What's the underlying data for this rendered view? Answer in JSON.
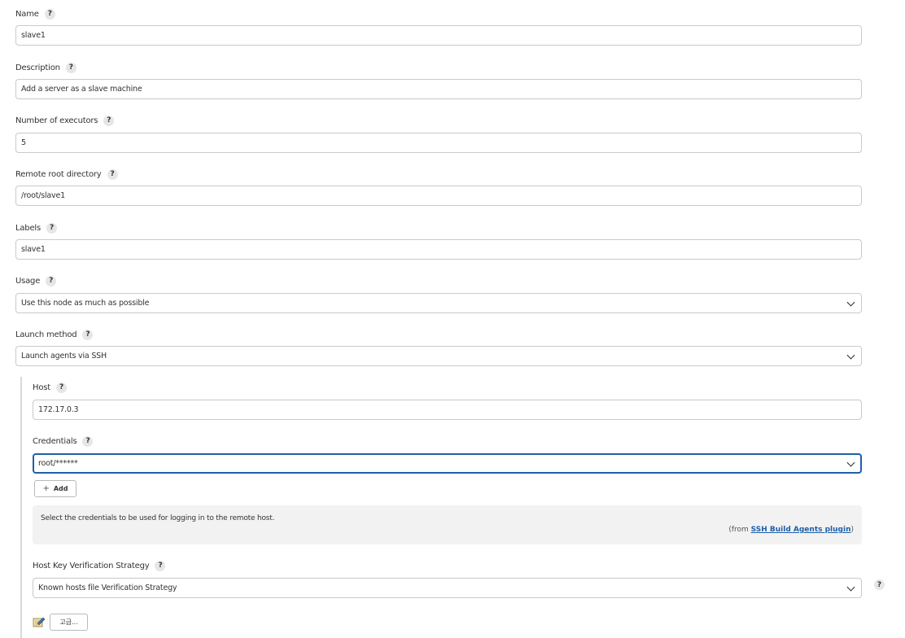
{
  "fields": {
    "name": {
      "label": "Name",
      "value": "slave1"
    },
    "description": {
      "label": "Description",
      "value": "Add a server as a slave machine"
    },
    "executors": {
      "label": "Number of executors",
      "value": "5"
    },
    "remote_root": {
      "label": "Remote root directory",
      "value": "/root/slave1"
    },
    "labels": {
      "label": "Labels",
      "value": "slave1"
    },
    "usage": {
      "label": "Usage",
      "value": "Use this node as much as possible"
    },
    "launch_method": {
      "label": "Launch method",
      "value": "Launch agents via SSH"
    }
  },
  "ssh": {
    "host": {
      "label": "Host",
      "value": "172.17.0.3"
    },
    "credentials": {
      "label": "Credentials",
      "value": "root/******"
    },
    "add_button": {
      "label": "Add"
    },
    "info": {
      "text": "Select the credentials to be used for logging in to the remote host.",
      "from_prefix": "(from ",
      "plugin_link": "SSH Build Agents plugin",
      "from_suffix": ")"
    },
    "host_key": {
      "label": "Host Key Verification Strategy",
      "value": "Known hosts file Verification Strategy"
    },
    "advanced_button": {
      "label": "고급..."
    }
  },
  "help_glyph": "?",
  "icons": {
    "help": "question-mark-icon",
    "dropdown": "chevron-down-icon",
    "add": "plus-icon",
    "edit": "notepad-edit-icon"
  },
  "colors": {
    "focus_border": "#1e5fa8",
    "link": "#1e5fa8",
    "info_bg": "#f2f2f2"
  }
}
